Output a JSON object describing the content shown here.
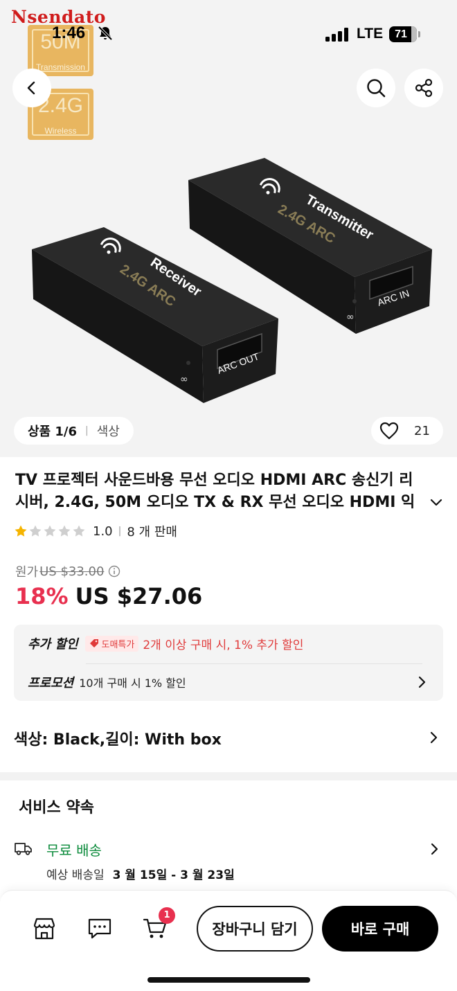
{
  "status_bar": {
    "time": "1:46",
    "network": "LTE",
    "battery": "71",
    "icons": [
      "bell-slash-icon",
      "signal-icon"
    ]
  },
  "hero": {
    "brand_logo": "Nsendato",
    "badges": [
      {
        "big": "50M",
        "small": "Transmission"
      },
      {
        "big": "2.4G",
        "small": "Wireless"
      }
    ],
    "transmitter": {
      "label": "Transmitter",
      "sublabel": "2.4G ARC",
      "port": "ARC IN"
    },
    "receiver": {
      "label": "Receiver",
      "sublabel": "2.4G ARC",
      "port": "ARC OUT"
    },
    "image_counter_label": "상품 1/6",
    "image_tab": "색상",
    "wishlist_count": "21"
  },
  "product": {
    "title": "TV 프로젝터 사운드바용 무선 오디오 HDMI ARC 송신기 리시버, 2.4G, 50M 오디오 TX & RX 무선 오디오 HDMI 익스텐더",
    "rating_value": 1.0,
    "rating_text": "1.0",
    "sold_text": "8 개 판매"
  },
  "price": {
    "original_label": "원가",
    "original_price": "US $33.00",
    "discount": "18%",
    "current_price": "US $27.06"
  },
  "promotions": {
    "extra_label": "추가 할인",
    "extra_tag": "도매특가",
    "extra_text": "2개 이상 구매 시, 1% 추가 할인",
    "promo_label": "프로모션",
    "promo_text": "10개 구매 시 1% 할인"
  },
  "variant": {
    "text": "색상: Black,길이: With box"
  },
  "service": {
    "title": "서비스 약속",
    "shipping_label": "무료 배송",
    "delivery_label": "예상 배송일",
    "delivery_dates": "3 월 15일 - 3 월 23일"
  },
  "bottom_bar": {
    "cart_count": "1",
    "add_to_cart": "장바구니 담기",
    "buy_now": "바로 구매"
  },
  "colors": {
    "accent": "#e8304f",
    "shipping": "#0a8a3a",
    "promo_red": "#e03a3a"
  }
}
